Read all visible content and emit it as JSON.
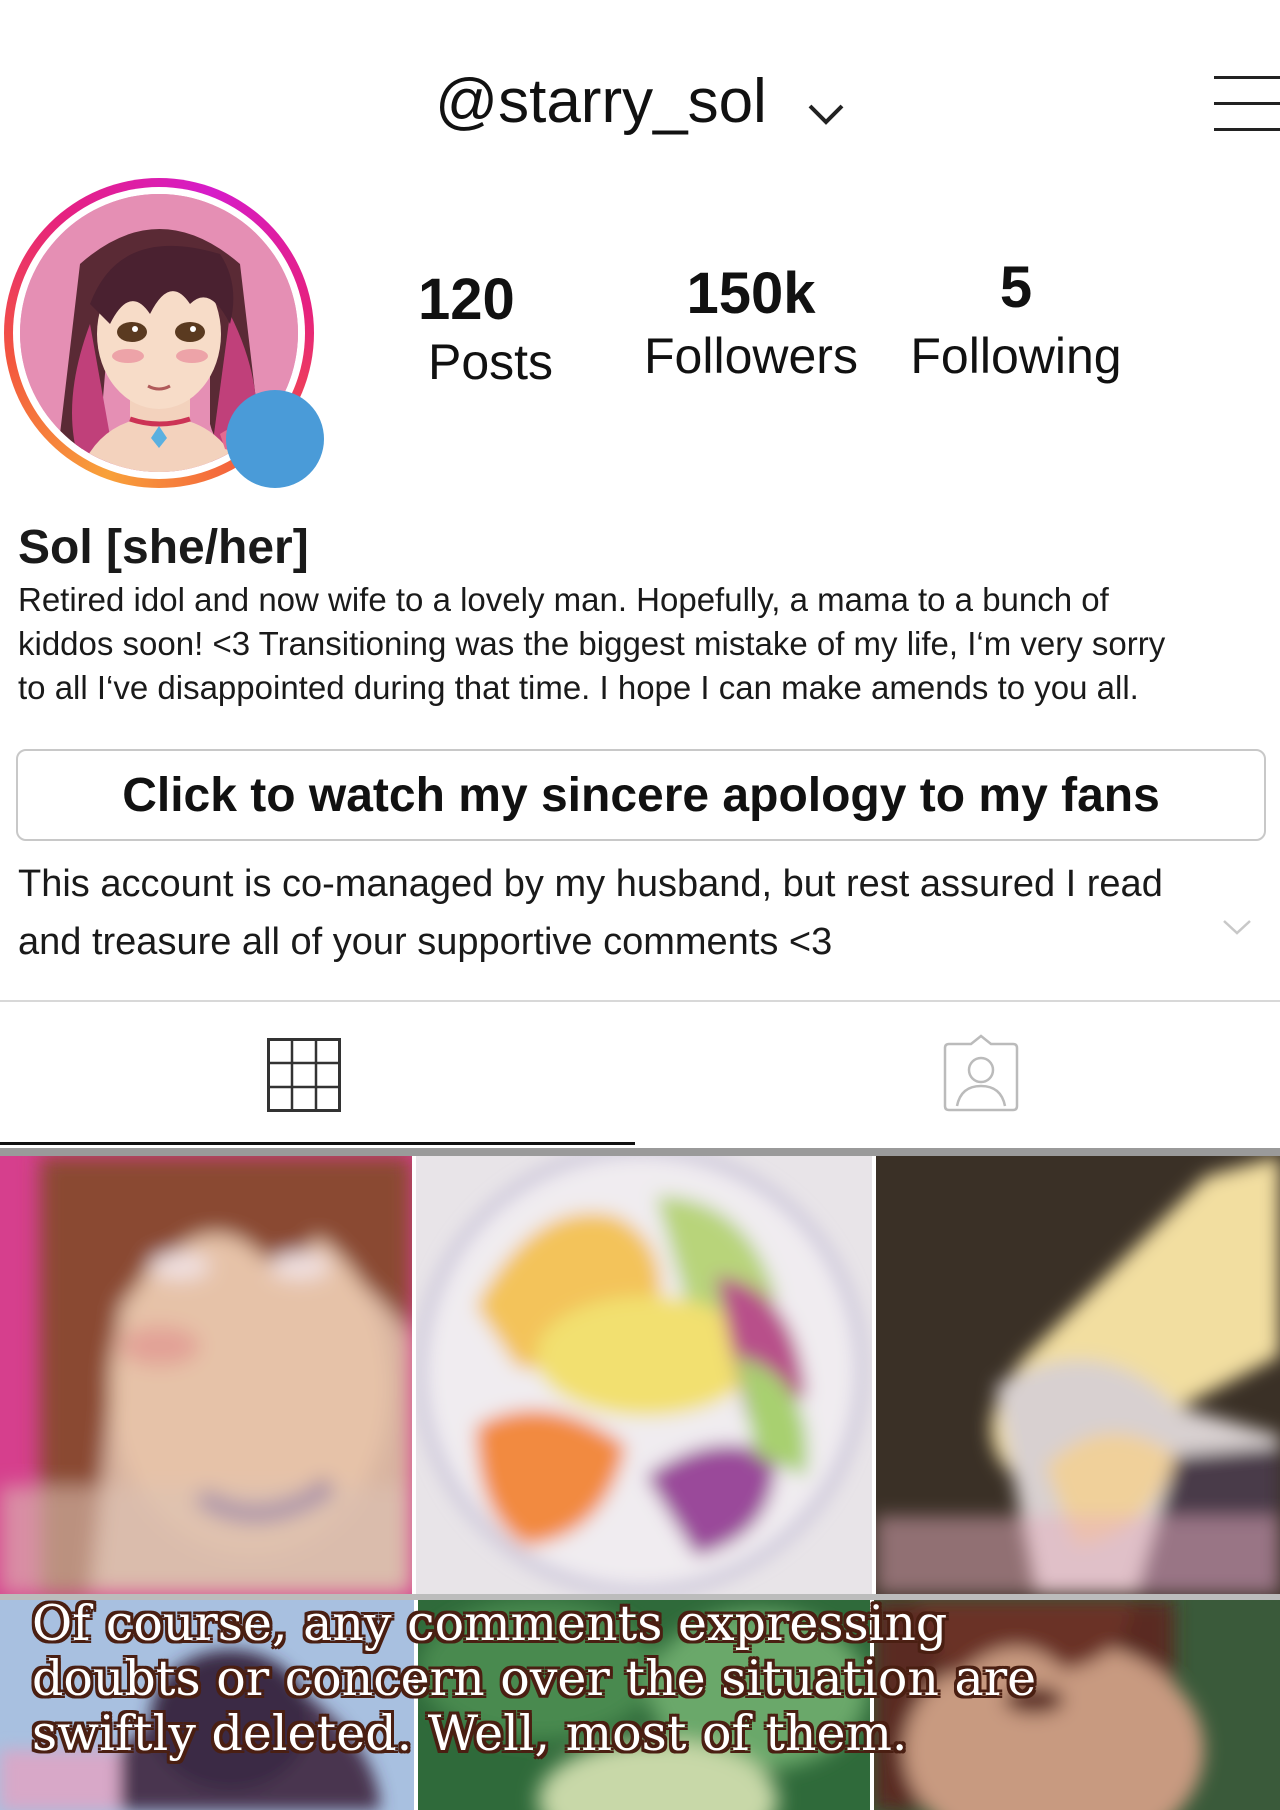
{
  "header": {
    "username": "@starry_sol"
  },
  "stats": {
    "posts": {
      "value": "120",
      "label": "Posts"
    },
    "followers": {
      "value": "150k",
      "label": "Followers"
    },
    "following": {
      "value": "5",
      "label": "Following"
    }
  },
  "profile": {
    "name": "Sol [she/her]",
    "bio_lines": [
      "Retired idol and now wife to a lovely man. Hopefully, a mama to a bunch of",
      "kiddos soon! <3 Transitioning was the biggest mistake of my life, I‘m very sorry",
      "to all I‘ve disappointed during that time. I hope I can make amends to you all."
    ],
    "apology_button": "Click to watch my sincere apology to my fans",
    "note_lines": [
      "This account is co-managed by my husband, but rest assured I read",
      "and treasure all of your supportive comments <3"
    ]
  },
  "tabs": [
    {
      "icon": "grid-icon",
      "active": true
    },
    {
      "icon": "tagged-icon",
      "active": false
    }
  ],
  "caption": {
    "lines": [
      "Of course, any comments expressing",
      "doubts or concern over the situation are",
      "swiftly deleted. Well, most of them."
    ]
  },
  "colors": {
    "status_dot": "#4a9bd8",
    "ring_start": "#f8a13a",
    "ring_end": "#d61cc9",
    "caption_outline": "#4a1f12"
  }
}
